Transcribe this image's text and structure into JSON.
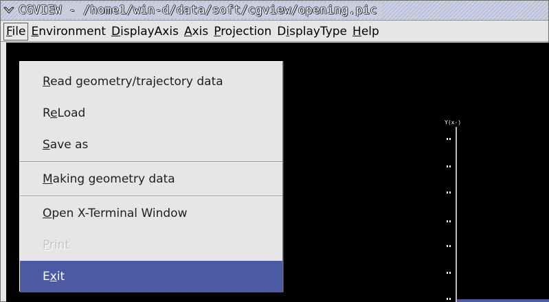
{
  "window": {
    "title": "CGVIEW  - /home1/win-d/data/soft/cgview/opening.pic",
    "menu_icon": "chevron-down-icon"
  },
  "menubar": {
    "items": [
      {
        "mnemonic": "F",
        "rest": "ile"
      },
      {
        "mnemonic": "E",
        "rest": "nvironment"
      },
      {
        "mnemonic": "D",
        "rest": "isplayAxis"
      },
      {
        "mnemonic": "A",
        "rest": "xis"
      },
      {
        "mnemonic": "P",
        "rest": "rojection"
      },
      {
        "pre": "D",
        "mnemonic": "i",
        "rest": "splayType"
      },
      {
        "mnemonic": "H",
        "rest": "elp"
      }
    ]
  },
  "file_menu": {
    "items": [
      {
        "mnemonic": "R",
        "rest": "ead geometry/trajectory data"
      },
      {
        "pre": "R",
        "mnemonic": "e",
        "rest": "Load"
      },
      {
        "mnemonic": "S",
        "rest": "ave as"
      },
      {
        "mnemonic": "M",
        "rest": "aking geometry data"
      },
      {
        "mnemonic": "O",
        "rest": "pen X-Terminal Window"
      },
      {
        "mnemonic": "P",
        "rest": "rint",
        "disabled": true
      },
      {
        "pre": "E",
        "mnemonic": "x",
        "rest": "it",
        "highlighted": true
      }
    ]
  },
  "canvas": {
    "axis_label": "Y(x-)",
    "background": "#000000",
    "highlight_color": "#4b5aa3"
  }
}
